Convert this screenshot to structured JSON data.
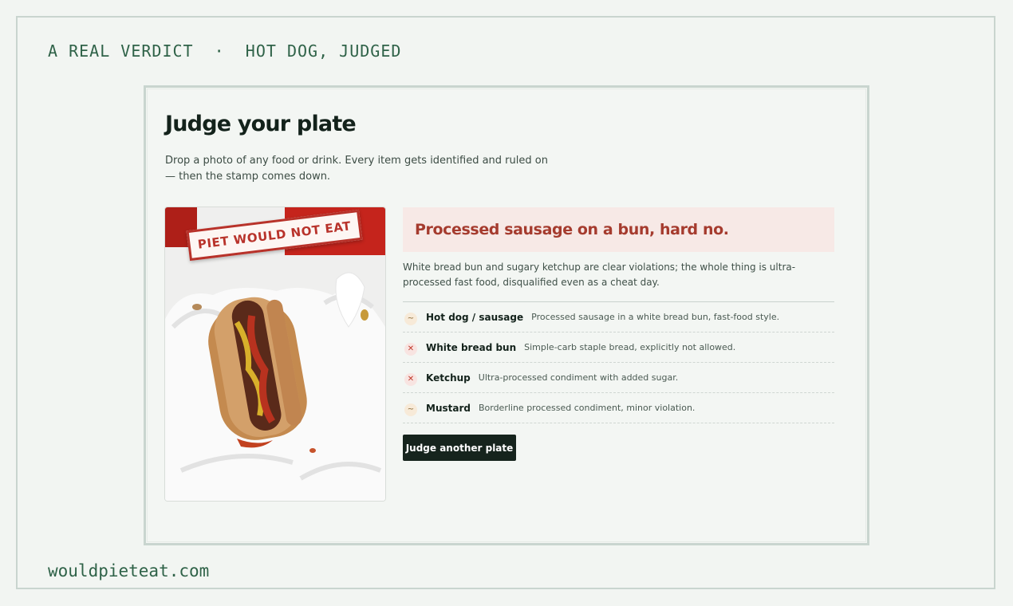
{
  "header": {
    "kicker": "A REAL VERDICT  ·  HOT DOG, JUDGED"
  },
  "footer": {
    "domain": "wouldpieteat.com"
  },
  "card": {
    "title": "Judge your plate",
    "subtitle": "Drop a photo of any food or drink. Every item gets identified and ruled on — then the stamp comes down.",
    "stamp_text": "PIET WOULD NOT EAT",
    "verdict": {
      "headline": "Processed sausage on a bun, hard no.",
      "reason": "White bread bun and sugary ketchup are clear violations; the whole thing is ultra-processed fast food, disqualified even as a cheat day."
    },
    "items": [
      {
        "status": "maybe",
        "symbol": "~",
        "name": "Hot dog / sausage",
        "note": "Processed sausage in a white bread bun, fast-food style."
      },
      {
        "status": "no",
        "symbol": "✕",
        "name": "White bread bun",
        "note": "Simple-carb staple bread, explicitly not allowed."
      },
      {
        "status": "no",
        "symbol": "✕",
        "name": "Ketchup",
        "note": "Ultra-processed condiment with added sugar."
      },
      {
        "status": "maybe",
        "symbol": "~",
        "name": "Mustard",
        "note": "Borderline processed condiment, minor violation."
      }
    ],
    "button_label": "Judge another plate"
  },
  "colors": {
    "accent_red": "#a53b2e",
    "stamp_red": "#b8322a",
    "dark": "#16241d",
    "green_text": "#2f6248",
    "maybe_badge": "#f7ead8",
    "no_badge": "#f8e4e1"
  }
}
